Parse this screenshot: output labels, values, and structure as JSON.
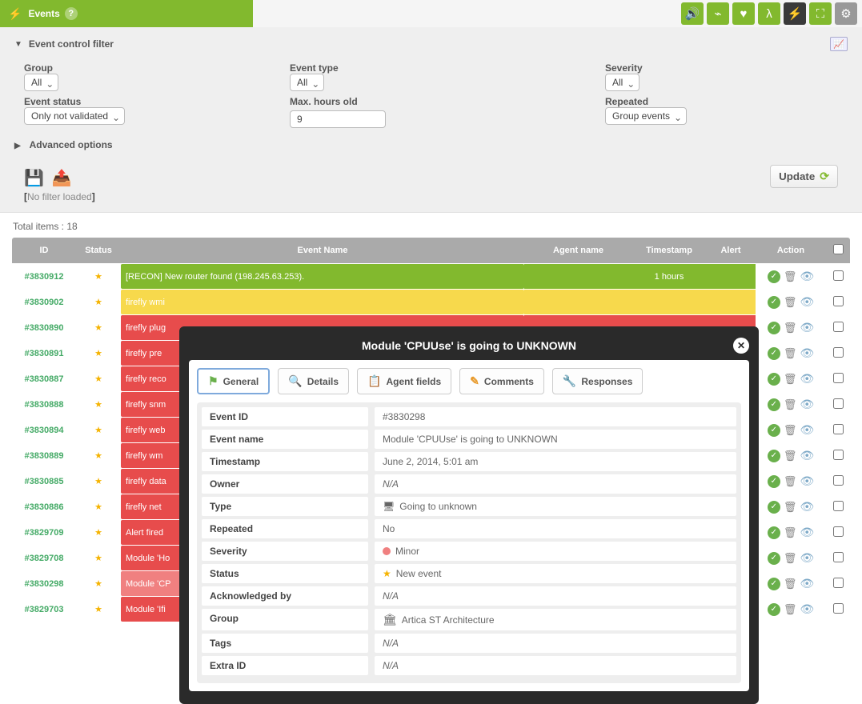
{
  "header": {
    "title": "Events"
  },
  "filter": {
    "title": "Event control filter",
    "group": {
      "label": "Group",
      "value": "All"
    },
    "event_type": {
      "label": "Event type",
      "value": "All"
    },
    "severity": {
      "label": "Severity",
      "value": "All"
    },
    "status": {
      "label": "Event status",
      "value": "Only not validated"
    },
    "max_hours": {
      "label": "Max. hours old",
      "value": "9"
    },
    "repeated": {
      "label": "Repeated",
      "value": "Group events"
    },
    "advanced": "Advanced options",
    "no_filter": "No filter loaded",
    "update": "Update"
  },
  "total": "Total items : 18",
  "columns": {
    "id": "ID",
    "status": "Status",
    "name": "Event Name",
    "agent": "Agent name",
    "ts": "Timestamp",
    "alert": "Alert",
    "action": "Action"
  },
  "events": [
    {
      "id": "#3830912",
      "name": "[RECON] New router found (198.245.63.253).",
      "ts": "1 hours",
      "cls": "bg-green"
    },
    {
      "id": "#3830902",
      "name": "firefly wmi",
      "ts": "",
      "cls": "bg-yellow"
    },
    {
      "id": "#3830890",
      "name": "firefly plug",
      "ts": "",
      "cls": "bg-red"
    },
    {
      "id": "#3830891",
      "name": "firefly pre",
      "ts": "",
      "cls": "bg-red"
    },
    {
      "id": "#3830887",
      "name": "firefly reco",
      "ts": "",
      "cls": "bg-red"
    },
    {
      "id": "#3830888",
      "name": "firefly snm",
      "ts": "",
      "cls": "bg-red"
    },
    {
      "id": "#3830894",
      "name": "firefly web",
      "ts": "",
      "cls": "bg-red"
    },
    {
      "id": "#3830889",
      "name": "firefly wm",
      "ts": "",
      "cls": "bg-red"
    },
    {
      "id": "#3830885",
      "name": "firefly data",
      "ts": "",
      "cls": "bg-red"
    },
    {
      "id": "#3830886",
      "name": "firefly net",
      "ts": "",
      "cls": "bg-red"
    },
    {
      "id": "#3829709",
      "name": "Alert fired",
      "ts": "",
      "cls": "bg-red"
    },
    {
      "id": "#3829708",
      "name": "Module 'Ho",
      "ts": "",
      "cls": "bg-red"
    },
    {
      "id": "#3830298",
      "name": "Module 'CP",
      "ts": "",
      "cls": "bg-pink"
    },
    {
      "id": "#3829703",
      "name": "Module 'Ifi",
      "ts": "",
      "cls": "bg-red"
    }
  ],
  "modal": {
    "title": "Module 'CPUUse' is going to UNKNOWN",
    "tabs": {
      "general": "General",
      "details": "Details",
      "agent": "Agent fields",
      "comments": "Comments",
      "responses": "Responses"
    },
    "rows": {
      "event_id": {
        "k": "Event ID",
        "v": "#3830298"
      },
      "event_name": {
        "k": "Event name",
        "v": "Module 'CPUUse' is going to UNKNOWN"
      },
      "timestamp": {
        "k": "Timestamp",
        "v": "June 2, 2014, 5:01 am"
      },
      "owner": {
        "k": "Owner",
        "v": "N/A"
      },
      "type": {
        "k": "Type",
        "v": "Going to unknown"
      },
      "repeated": {
        "k": "Repeated",
        "v": "No"
      },
      "severity": {
        "k": "Severity",
        "v": "Minor"
      },
      "status": {
        "k": "Status",
        "v": "New event"
      },
      "ack": {
        "k": "Acknowledged by",
        "v": "N/A"
      },
      "group": {
        "k": "Group",
        "v": "Artica ST Architecture"
      },
      "tags": {
        "k": "Tags",
        "v": "N/A"
      },
      "extra": {
        "k": "Extra ID",
        "v": "N/A"
      }
    }
  }
}
